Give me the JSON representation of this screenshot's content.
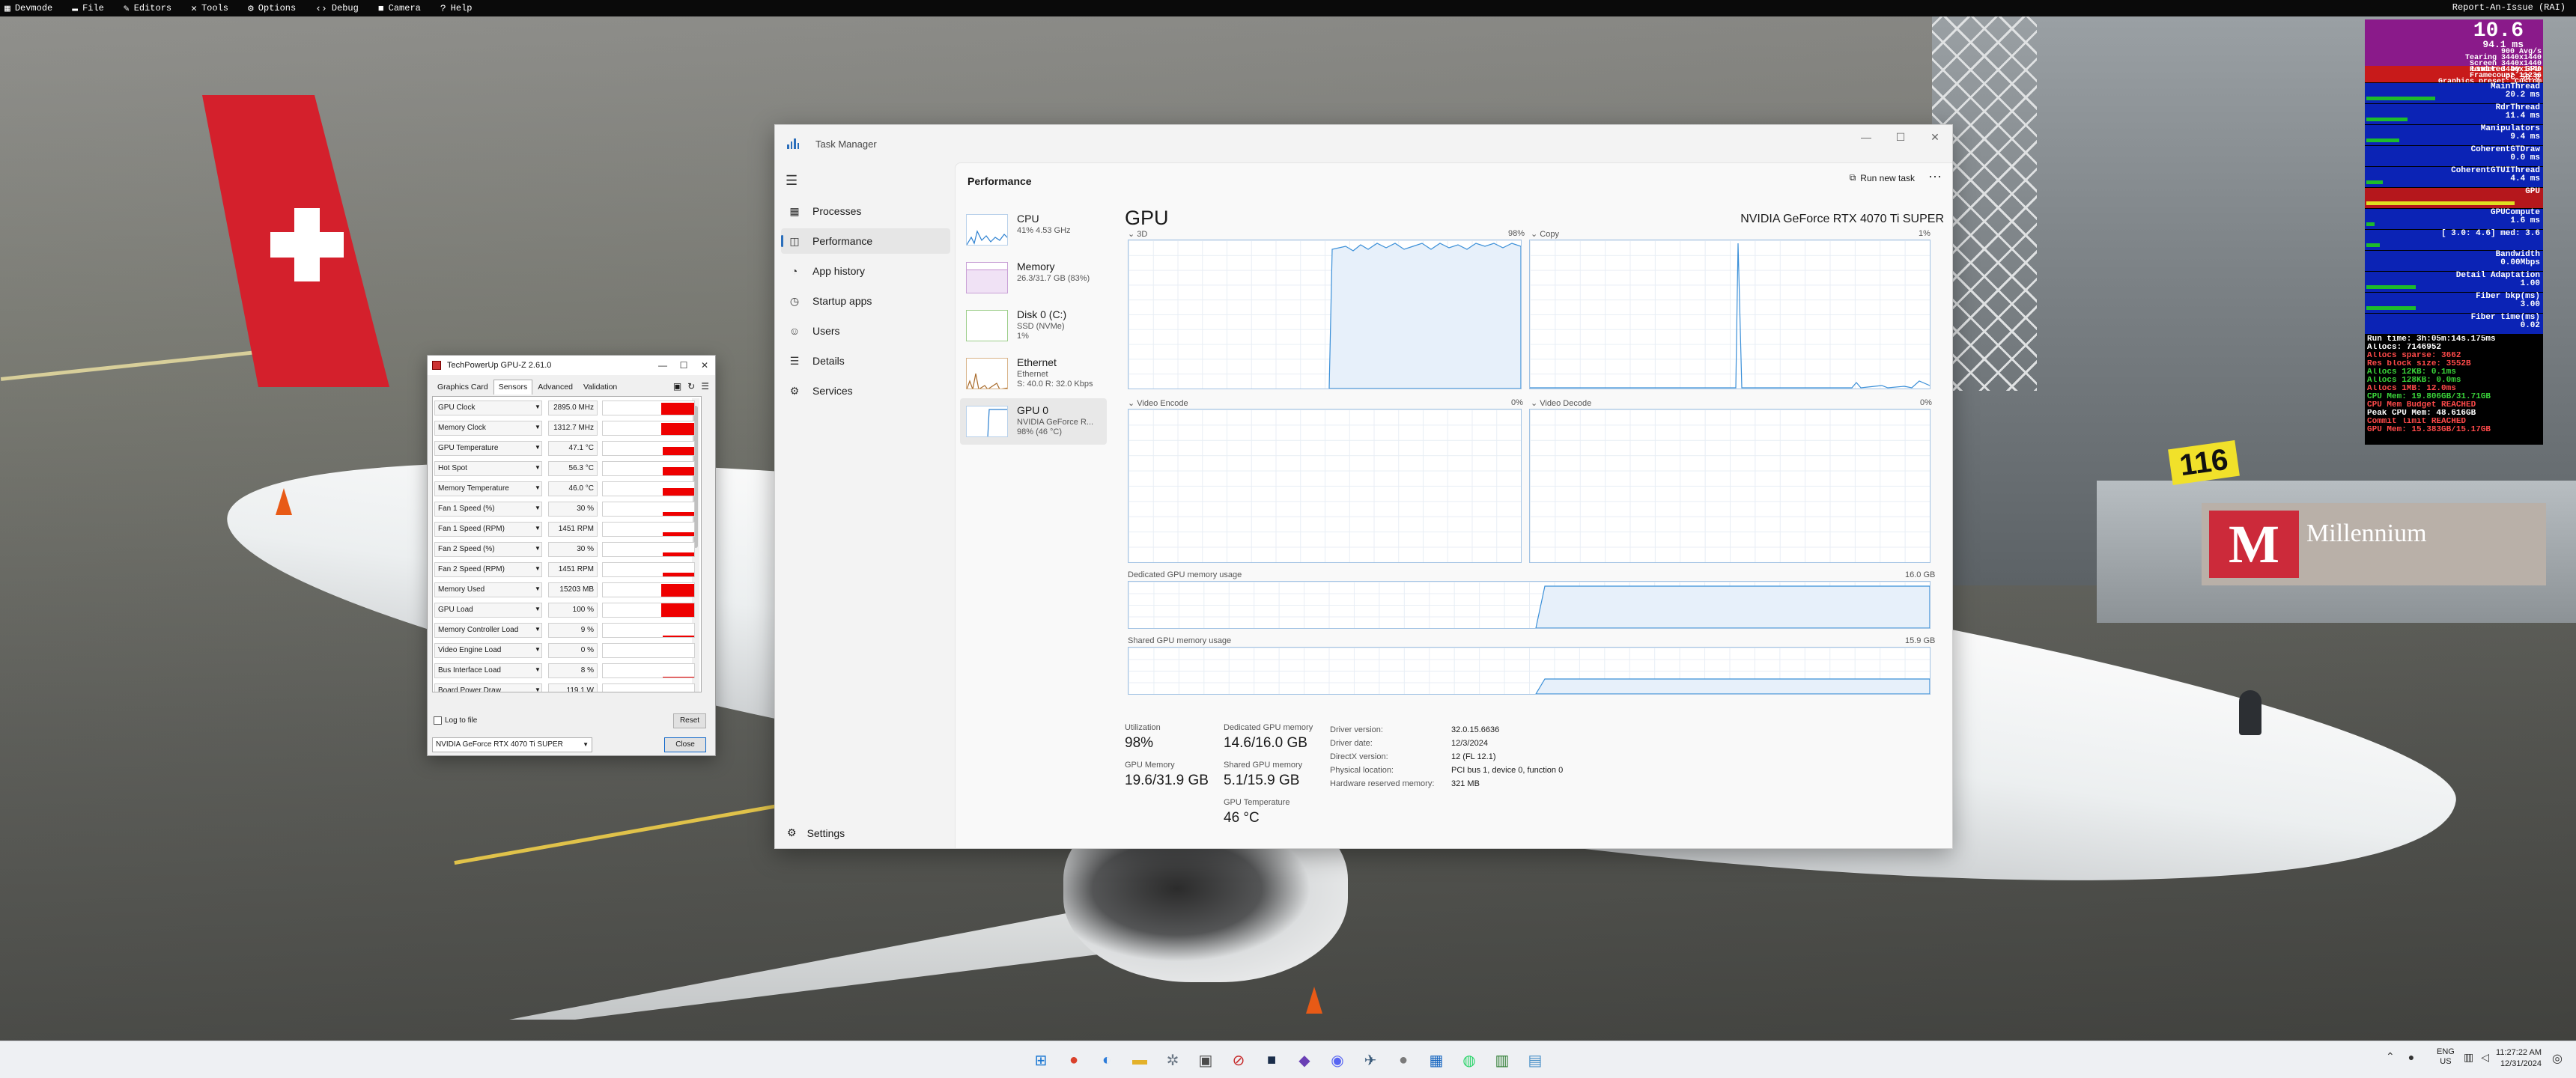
{
  "devbar": {
    "menus": [
      {
        "label": "Devmode",
        "icon": "devmode-icon"
      },
      {
        "label": "File",
        "icon": "folder-icon"
      },
      {
        "label": "Editors",
        "icon": "pencil-icon"
      },
      {
        "label": "Tools",
        "icon": "wrench-icon"
      },
      {
        "label": "Options",
        "icon": "gear-icon"
      },
      {
        "label": "Debug",
        "icon": "code-icon"
      },
      {
        "label": "Camera",
        "icon": "camera-icon"
      },
      {
        "label": "Help",
        "icon": "help-icon"
      }
    ],
    "report": "Report-An-Issue (RAI)"
  },
  "overlay": {
    "fps": "10.6",
    "ms": "94.1 ms",
    "fps_lines": [
      "900 Avg/s",
      "Tearing 3440x1440",
      "Screen 3440x1440",
      "Render 3440x1440",
      "Framecount 11236",
      "Graphics preset: Custom"
    ],
    "limit_label": "Limited by GPU",
    "limit_sub": "PC 50.0",
    "blocks": [
      {
        "label": "MainThread",
        "value": "20.2 ms",
        "fill": 0.42
      },
      {
        "label": "RdrThread",
        "value": "11.4 ms",
        "fill": 0.25
      },
      {
        "label": "Manipulators",
        "value": "9.4 ms",
        "fill": 0.2
      },
      {
        "label": "CoherentGTDraw",
        "value": "0.0 ms",
        "fill": 0.0
      },
      {
        "label": "CoherentGTUIThread",
        "value": "4.4 ms",
        "fill": 0.1
      },
      {
        "label": "GPU",
        "value": "",
        "fill": 0.9
      },
      {
        "label": "GPUCompute",
        "value": "1.6 ms",
        "fill": 0.05
      },
      {
        "label": "[ 3.0: 4.6] med: 3.6",
        "value": "",
        "fill": 0.08
      },
      {
        "label": "Bandwidth",
        "value": "0.00Mbps",
        "fill": 0.0
      },
      {
        "label": "Detail Adaptation",
        "value": "1.00",
        "fill": 0.3
      },
      {
        "label": "Fiber bkp(ms)",
        "value": "3.00",
        "fill": 0.3
      },
      {
        "label": "Fiber time(ms)",
        "value": "0.02",
        "fill": 0.0
      }
    ],
    "info_lines": [
      {
        "text": "Run time: 3h:05m:14s.175ms",
        "color": "#ffffff"
      },
      {
        "text": "Allocs: 7146952",
        "color": "#ffffff"
      },
      {
        "text": "Allocs sparse: 3662",
        "color": "#ff4a4a"
      },
      {
        "text": "Res block size: 3552B",
        "color": "#ff4a4a"
      },
      {
        "text": "Allocs 12KB: 0.1ms",
        "color": "#3ad43a"
      },
      {
        "text": "Allocs 128KB: 0.0ms",
        "color": "#3ad43a"
      },
      {
        "text": "Allocs 1MB: 12.0ms",
        "color": "#ff4a4a"
      },
      {
        "text": "CPU Mem: 19.806GB/31.71GB",
        "color": "#3ad43a"
      },
      {
        "text": "CPU Mem Budget REACHED",
        "color": "#ff4a4a"
      },
      {
        "text": "Peak CPU Mem: 48.616GB",
        "color": "#ffffff"
      },
      {
        "text": "Commit limit REACHED",
        "color": "#ff4a4a"
      },
      {
        "text": "GPU Mem: 15.383GB/15.17GB",
        "color": "#ff4a4a"
      }
    ]
  },
  "taskmanager": {
    "title": "Task Manager",
    "nav": [
      {
        "label": "Processes",
        "icon": "processes-icon"
      },
      {
        "label": "Performance",
        "icon": "performance-icon",
        "selected": true
      },
      {
        "label": "App history",
        "icon": "history-icon"
      },
      {
        "label": "Startup apps",
        "icon": "startup-icon"
      },
      {
        "label": "Users",
        "icon": "users-icon"
      },
      {
        "label": "Details",
        "icon": "details-icon"
      },
      {
        "label": "Services",
        "icon": "services-icon"
      }
    ],
    "settings": "Settings",
    "header": "Performance",
    "run_new_task": "Run new task",
    "perf_items": [
      {
        "name": "CPU",
        "sub": "41% 4.53 GHz",
        "kind": "cpu"
      },
      {
        "name": "Memory",
        "sub": "26.3/31.7 GB (83%)",
        "kind": "mem"
      },
      {
        "name": "Disk 0 (C:)",
        "sub": "SSD (NVMe)\n1%",
        "kind": "disk"
      },
      {
        "name": "Ethernet",
        "sub": "Ethernet\nS: 40.0 R: 32.0 Kbps",
        "kind": "eth"
      },
      {
        "name": "GPU 0",
        "sub": "NVIDIA GeForce R...\n98% (46 °C)",
        "kind": "gpu",
        "selected": true
      }
    ],
    "gpu": {
      "title": "GPU",
      "model": "NVIDIA GeForce RTX 4070 Ti SUPER",
      "graphs": [
        {
          "label": "3D",
          "pct": "98%"
        },
        {
          "label": "Copy",
          "pct": "1%"
        },
        {
          "label": "Video Encode",
          "pct": "0%"
        },
        {
          "label": "Video Decode",
          "pct": "0%"
        }
      ],
      "dedicated_label": "Dedicated GPU memory usage",
      "dedicated_max": "16.0 GB",
      "shared_label": "Shared GPU memory usage",
      "shared_max": "15.9 GB",
      "stats": [
        {
          "k": "Utilization",
          "v": "98%"
        },
        {
          "k": "Dedicated GPU memory",
          "v": "14.6/16.0 GB"
        },
        {
          "k": "GPU Memory",
          "v": "19.6/31.9 GB"
        },
        {
          "k": "Shared GPU memory",
          "v": "5.1/15.9 GB"
        },
        {
          "k": "GPU Temperature",
          "v": "46 °C"
        }
      ],
      "details_keys": [
        "Driver version:",
        "Driver date:",
        "DirectX version:",
        "Physical location:",
        "Hardware reserved memory:"
      ],
      "details_vals": [
        "32.0.15.6636",
        "12/3/2024",
        "12 (FL 12.1)",
        "PCI bus 1, device 0, function 0",
        "321 MB"
      ]
    }
  },
  "gpuz": {
    "title": "TechPowerUp GPU-Z 2.61.0",
    "tabs": [
      "Graphics Card",
      "Sensors",
      "Advanced",
      "Validation"
    ],
    "selected_tab": "Sensors",
    "sensors": [
      {
        "name": "GPU Clock",
        "value": "2895.0 MHz",
        "level": 0.9
      },
      {
        "name": "Memory Clock",
        "value": "1312.7 MHz",
        "level": 0.9
      },
      {
        "name": "GPU Temperature",
        "value": "47.1 °C",
        "level": 0.6
      },
      {
        "name": "Hot Spot",
        "value": "56.3 °C",
        "level": 0.6
      },
      {
        "name": "Memory Temperature",
        "value": "46.0 °C",
        "level": 0.55
      },
      {
        "name": "Fan 1 Speed (%)",
        "value": "30 %",
        "level": 0.3
      },
      {
        "name": "Fan 1 Speed (RPM)",
        "value": "1451 RPM",
        "level": 0.3
      },
      {
        "name": "Fan 2 Speed (%)",
        "value": "30 %",
        "level": 0.3
      },
      {
        "name": "Fan 2 Speed (RPM)",
        "value": "1451 RPM",
        "level": 0.3
      },
      {
        "name": "Memory Used",
        "value": "15203 MB",
        "level": 0.95
      },
      {
        "name": "GPU Load",
        "value": "100 %",
        "level": 1.0
      },
      {
        "name": "Memory Controller Load",
        "value": "9 %",
        "level": 0.09
      },
      {
        "name": "Video Engine Load",
        "value": "0 %",
        "level": 0.0
      },
      {
        "name": "Bus Interface Load",
        "value": "8 %",
        "level": 0.08
      },
      {
        "name": "Board Power Draw",
        "value": "119.1 W",
        "level": 0.4
      }
    ],
    "log_to_file": "Log to file",
    "reset": "Reset",
    "gpu_select": "NVIDIA GeForce RTX 4070 Ti SUPER",
    "close": "Close"
  },
  "taskbar": {
    "apps": [
      {
        "name": "start-icon",
        "glyph": "⊞",
        "color": "#1976d2"
      },
      {
        "name": "chrome-icon",
        "glyph": "●",
        "color": "#d9412b"
      },
      {
        "name": "edge-icon",
        "glyph": "◐",
        "color": "#2b7bd9"
      },
      {
        "name": "file-explorer-icon",
        "glyph": "▬",
        "color": "#e3b12a"
      },
      {
        "name": "settings-icon",
        "glyph": "✲",
        "color": "#6b7785"
      },
      {
        "name": "app-icon",
        "glyph": "▣",
        "color": "#4b4b4b"
      },
      {
        "name": "app-red-icon",
        "glyph": "⊘",
        "color": "#c62828"
      },
      {
        "name": "app-dark-icon",
        "glyph": "■",
        "color": "#1a2d4a"
      },
      {
        "name": "app-purple-icon",
        "glyph": "◆",
        "color": "#6a3fb5"
      },
      {
        "name": "discord-icon",
        "glyph": "◉",
        "color": "#5865f2"
      },
      {
        "name": "app-plane-icon",
        "glyph": "✈",
        "color": "#3a5a7a"
      },
      {
        "name": "app-grey-icon",
        "glyph": "●",
        "color": "#7a7a7a"
      },
      {
        "name": "app-blue-icon",
        "glyph": "▦",
        "color": "#1565c0"
      },
      {
        "name": "whatsapp-icon",
        "glyph": "◍",
        "color": "#25d366"
      },
      {
        "name": "app-green-icon",
        "glyph": "▥",
        "color": "#2e7d32"
      },
      {
        "name": "app-gallery-icon",
        "glyph": "▤",
        "color": "#4a90c8"
      }
    ],
    "lang1": "ENG",
    "lang2": "US",
    "time": "11:27:22 AM",
    "date": "12/31/2024"
  }
}
